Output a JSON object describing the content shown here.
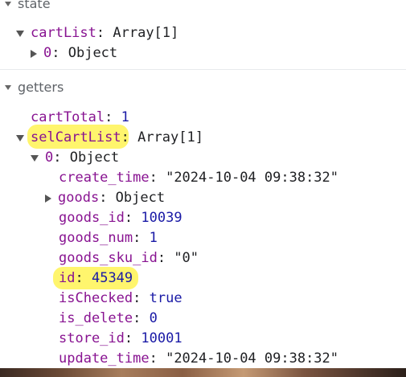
{
  "sections": {
    "state": "state",
    "getters": "getters"
  },
  "state": {
    "cartList_key": "cartList",
    "cartList_type": "Array[1]",
    "item0_key": "0",
    "item0_type": "Object"
  },
  "getters": {
    "cartTotal_key": "cartTotal",
    "cartTotal_value": "1",
    "selCartList_key": "selCartList",
    "selCartList_type": "Array[1]",
    "item0_key": "0",
    "item0_type": "Object",
    "fields": {
      "create_time_key": "create_time",
      "create_time_value": "\"2024-10-04 09:38:32\"",
      "goods_key": "goods",
      "goods_type": "Object",
      "goods_id_key": "goods_id",
      "goods_id_value": "10039",
      "goods_num_key": "goods_num",
      "goods_num_value": "1",
      "goods_sku_id_key": "goods_sku_id",
      "goods_sku_id_value": "\"0\"",
      "id_key": "id",
      "id_value": "45349",
      "isChecked_key": "isChecked",
      "isChecked_value": "true",
      "is_delete_key": "is_delete",
      "is_delete_value": "0",
      "store_id_key": "store_id",
      "store_id_value": "10001",
      "update_time_key": "update_time",
      "update_time_value": "\"2024-10-04 09:38:32\""
    }
  },
  "colors": {
    "key": "#881391",
    "number": "#1a1aa6",
    "text": "#202124",
    "section": "#5f6368",
    "highlight": "#fff23c"
  }
}
